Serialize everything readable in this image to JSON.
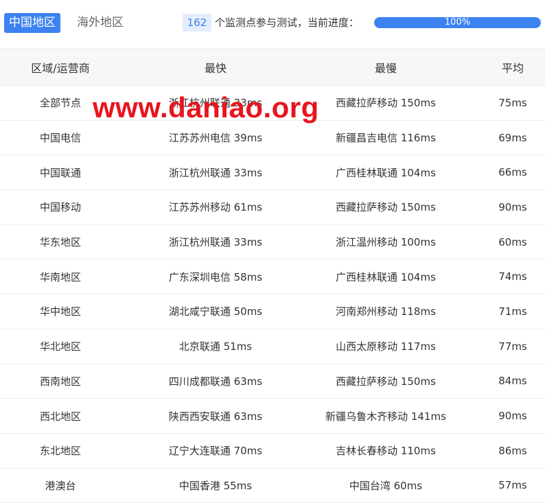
{
  "tabs": {
    "active_label": "中国地区",
    "inactive_label": "海外地区"
  },
  "monitor": {
    "count": "162",
    "text": "个监测点参与测试，当前进度：",
    "progress_label": "100%",
    "progress_value": 1.0
  },
  "table": {
    "headers": [
      "区域/运营商",
      "最快",
      "最慢",
      "平均"
    ],
    "rows": [
      [
        "全部节点",
        "浙江杭州联通 33ms",
        "西藏拉萨移动 150ms",
        "75ms"
      ],
      [
        "中国电信",
        "江苏苏州电信 39ms",
        "新疆昌吉电信 116ms",
        "69ms"
      ],
      [
        "中国联通",
        "浙江杭州联通 33ms",
        "广西桂林联通 104ms",
        "66ms"
      ],
      [
        "中国移动",
        "江苏苏州移动 61ms",
        "西藏拉萨移动 150ms",
        "90ms"
      ],
      [
        "华东地区",
        "浙江杭州联通 33ms",
        "浙江温州移动 100ms",
        "60ms"
      ],
      [
        "华南地区",
        "广东深圳电信 58ms",
        "广西桂林联通 104ms",
        "74ms"
      ],
      [
        "华中地区",
        "湖北咸宁联通 50ms",
        "河南郑州移动 118ms",
        "71ms"
      ],
      [
        "华北地区",
        "北京联通 51ms",
        "山西太原移动 117ms",
        "77ms"
      ],
      [
        "西南地区",
        "四川成都联通 63ms",
        "西藏拉萨移动 150ms",
        "84ms"
      ],
      [
        "西北地区",
        "陕西西安联通 63ms",
        "新疆乌鲁木齐移动 141ms",
        "90ms"
      ],
      [
        "东北地区",
        "辽宁大连联通 70ms",
        "吉林长春移动 110ms",
        "86ms"
      ],
      [
        "港澳台",
        "中国香港 55ms",
        "中国台湾 60ms",
        "57ms"
      ]
    ]
  },
  "watermark": "www.daniao.org",
  "colors": {
    "accent": "#3c82f0",
    "watermark": "#e8141e"
  }
}
